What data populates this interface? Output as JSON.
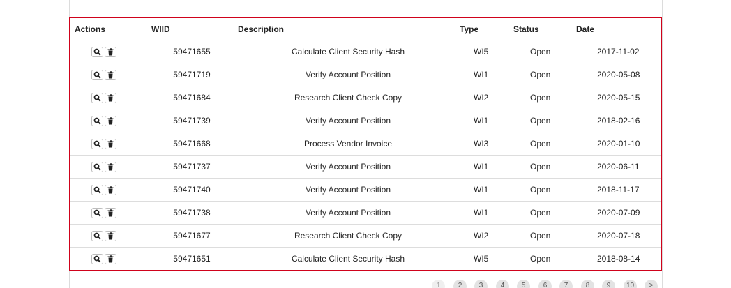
{
  "table": {
    "headers": {
      "actions": "Actions",
      "wiid": "WIID",
      "description": "Description",
      "type": "Type",
      "status": "Status",
      "date": "Date"
    },
    "rows": [
      {
        "wiid": "59471655",
        "description": "Calculate Client Security Hash",
        "type": "WI5",
        "status": "Open",
        "date": "2017-11-02"
      },
      {
        "wiid": "59471719",
        "description": "Verify Account Position",
        "type": "WI1",
        "status": "Open",
        "date": "2020-05-08"
      },
      {
        "wiid": "59471684",
        "description": "Research Client Check Copy",
        "type": "WI2",
        "status": "Open",
        "date": "2020-05-15"
      },
      {
        "wiid": "59471739",
        "description": "Verify Account Position",
        "type": "WI1",
        "status": "Open",
        "date": "2018-02-16"
      },
      {
        "wiid": "59471668",
        "description": "Process Vendor Invoice",
        "type": "WI3",
        "status": "Open",
        "date": "2020-01-10"
      },
      {
        "wiid": "59471737",
        "description": "Verify Account Position",
        "type": "WI1",
        "status": "Open",
        "date": "2020-06-11"
      },
      {
        "wiid": "59471740",
        "description": "Verify Account Position",
        "type": "WI1",
        "status": "Open",
        "date": "2018-11-17"
      },
      {
        "wiid": "59471738",
        "description": "Verify Account Position",
        "type": "WI1",
        "status": "Open",
        "date": "2020-07-09"
      },
      {
        "wiid": "59471677",
        "description": "Research Client Check Copy",
        "type": "WI2",
        "status": "Open",
        "date": "2020-07-18"
      },
      {
        "wiid": "59471651",
        "description": "Calculate Client Security Hash",
        "type": "WI5",
        "status": "Open",
        "date": "2018-08-14"
      }
    ],
    "row_actions": {
      "view_icon": "search-icon",
      "delete_icon": "trash-icon"
    }
  },
  "pagination": {
    "pages": [
      "1",
      "2",
      "3",
      "4",
      "5",
      "6",
      "7",
      "8",
      "9",
      "10"
    ],
    "next_label": ">"
  },
  "colors": {
    "highlight_border": "#d0021b",
    "row_divider": "#dddddd",
    "pager_bg": "#e3e3e3"
  }
}
